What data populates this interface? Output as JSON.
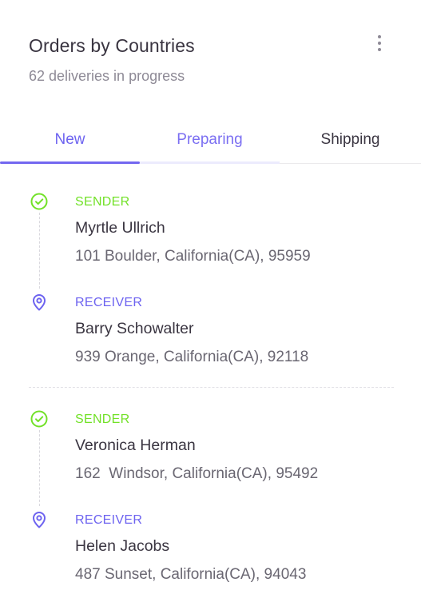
{
  "header": {
    "title": "Orders by Countries",
    "subtitle": "62 deliveries in progress",
    "menu_icon": "more-vertical-icon"
  },
  "tabs": [
    {
      "label": "New",
      "active": true
    },
    {
      "label": "Preparing",
      "active": false
    },
    {
      "label": "Shipping",
      "active": false
    }
  ],
  "orders": [
    {
      "sender": {
        "role": "SENDER",
        "name": "Myrtle Ullrich",
        "address": "101 Boulder, California(CA), 95959",
        "icon": "check-circle-icon",
        "color": "#72e128"
      },
      "receiver": {
        "role": "RECEIVER",
        "name": "Barry Schowalter",
        "address": "939 Orange, California(CA), 92118",
        "icon": "map-pin-icon",
        "color": "#6d63f0"
      }
    },
    {
      "sender": {
        "role": "SENDER",
        "name": "Veronica Herman",
        "address": "162  Windsor, California(CA), 95492",
        "icon": "check-circle-icon",
        "color": "#72e128"
      },
      "receiver": {
        "role": "RECEIVER",
        "name": "Helen Jacobs",
        "address": "487 Sunset, California(CA), 94043",
        "icon": "map-pin-icon",
        "color": "#6d63f0"
      }
    }
  ],
  "colors": {
    "accent": "#7367f0",
    "success": "#72e128"
  }
}
